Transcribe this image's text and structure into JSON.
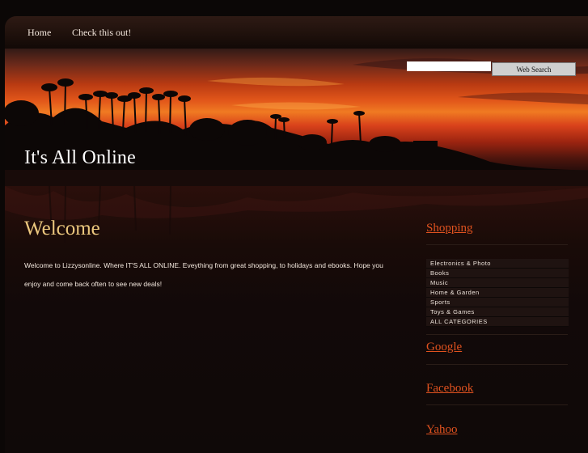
{
  "nav": {
    "items": [
      {
        "label": "Home"
      },
      {
        "label": "Check this out!"
      }
    ]
  },
  "header": {
    "site_title": "It's All Online",
    "search": {
      "value": "",
      "button_label": "Web Search"
    }
  },
  "main": {
    "title": "Welcome",
    "text": "Welcome to Lizzysonline. Where IT'S ALL ONLINE. Eveything from great shopping, to holidays and ebooks. Hope you enjoy and come back often to see new deals!"
  },
  "sidebar": {
    "shopping_title": "Shopping",
    "shopping_items": [
      "Electronics & Photo",
      "Books",
      "Music",
      "Home & Garden",
      "Sports",
      "Toys & Games",
      "ALL CATEGORIES"
    ],
    "links": [
      {
        "label": "Google"
      },
      {
        "label": "Facebook"
      },
      {
        "label": "Yahoo"
      }
    ]
  },
  "colors": {
    "accent_link": "#e0521f",
    "welcome_title": "#ecc87e",
    "page_bg": "#110b0a"
  }
}
